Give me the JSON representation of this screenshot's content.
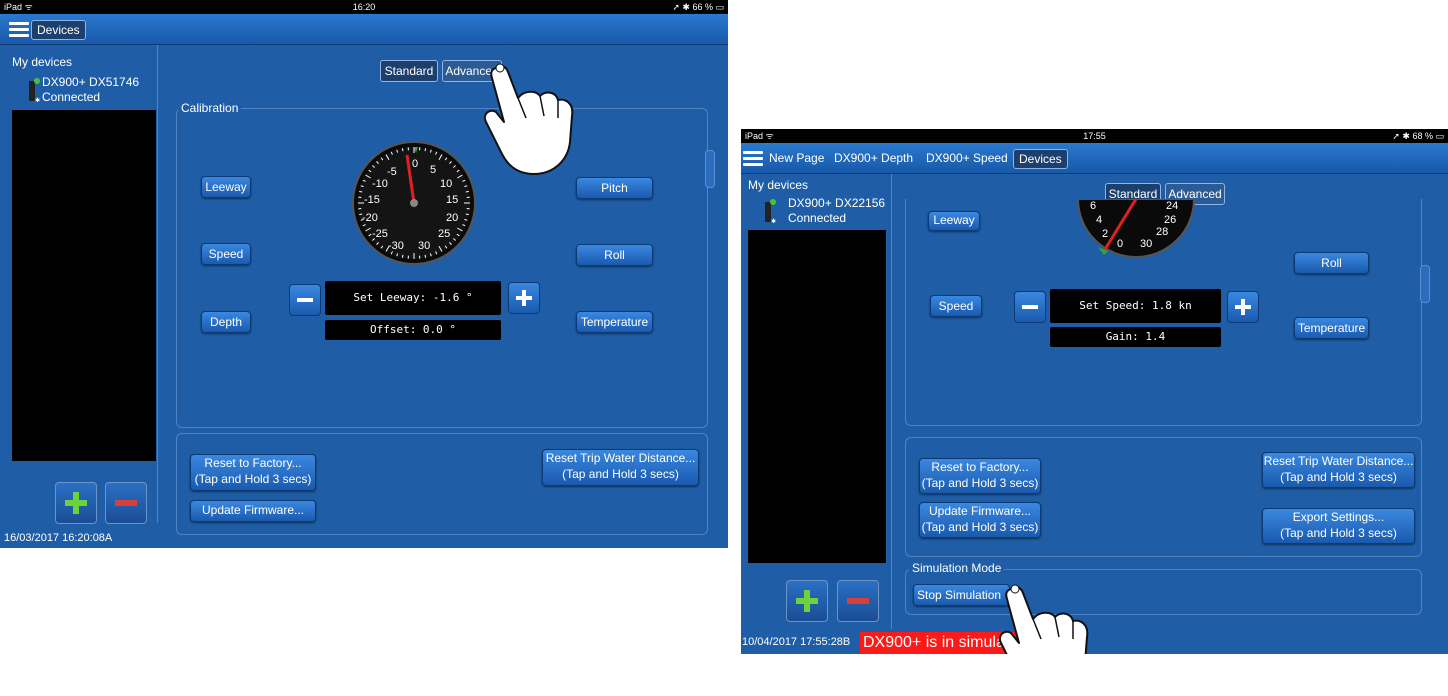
{
  "left": {
    "statusbar": {
      "carrier": "iPad ᯤ",
      "time": "16:20",
      "battery": "➚ ✱ 66 % ▭"
    },
    "nav": {
      "active_tab": "Devices"
    },
    "sidebar": {
      "title": "My devices",
      "device_name": "DX900+ DX51746",
      "device_status": "Connected"
    },
    "segmented": [
      "Standard",
      "Advanced"
    ],
    "calibration": {
      "legend": "Calibration",
      "buttons_left": [
        "Leeway",
        "Speed",
        "Depth"
      ],
      "buttons_right": [
        "Pitch",
        "Roll",
        "Temperature"
      ],
      "set_value": "Set Leeway: -1.6 °",
      "offset_value": "Offset: 0.0 °",
      "gauge_labels_left": [
        "-5",
        "-10",
        "-15",
        "-20",
        "-25",
        "-30"
      ],
      "gauge_labels_right": [
        "0",
        "5",
        "10",
        "15",
        "20",
        "25",
        "30"
      ]
    },
    "actions": {
      "reset_factory": "Reset to Factory...",
      "reset_factory_sub": "(Tap and Hold 3 secs)",
      "reset_trip": "Reset Trip Water Distance...",
      "reset_trip_sub": "(Tap and Hold 3 secs)",
      "update_firmware": "Update Firmware..."
    },
    "timestamp": "16/03/2017 16:20:08A"
  },
  "right": {
    "statusbar": {
      "carrier": "iPad ᯤ",
      "time": "17:55",
      "battery": "➚ ✱ 68 % ▭"
    },
    "nav": {
      "items": [
        "New Page",
        "DX900+ Depth",
        "DX900+ Speed"
      ],
      "active_tab": "Devices"
    },
    "sidebar": {
      "title": "My devices",
      "device_name": "DX900+ DX22156",
      "device_status": "Connected"
    },
    "segmented": [
      "Standard",
      "Advanced"
    ],
    "calibration": {
      "buttons_left": [
        "Leeway",
        "Speed"
      ],
      "buttons_right": [
        "Roll",
        "Temperature"
      ],
      "set_value": "Set Speed: 1.8 kn",
      "gain_value": "Gain: 1.4",
      "gauge_labels_left": [
        "6",
        "4",
        "2",
        "0"
      ],
      "gauge_labels_right": [
        "24",
        "26",
        "28",
        "30"
      ]
    },
    "actions": {
      "reset_factory": "Reset to Factory...",
      "reset_factory_sub": "(Tap and Hold 3 secs)",
      "reset_trip": "Reset Trip Water Distance...",
      "reset_trip_sub": "(Tap and Hold 3 secs)",
      "update_firmware": "Update Firmware...",
      "update_firmware_sub": "(Tap and Hold 3 secs)",
      "export_settings": "Export Settings...",
      "export_settings_sub": "(Tap and Hold 3 secs)"
    },
    "simulation": {
      "legend": "Simulation Mode",
      "stop_button": "Stop Simulation"
    },
    "timestamp": "10/04/2017 17:55:28B",
    "warning": "DX900+ is in simulation mode"
  },
  "colors": {
    "background": "#1f5ea6",
    "warning": "#ff1a1a",
    "plus": "#6cd43a",
    "minus": "#d6403a",
    "needle": "#e02020"
  }
}
